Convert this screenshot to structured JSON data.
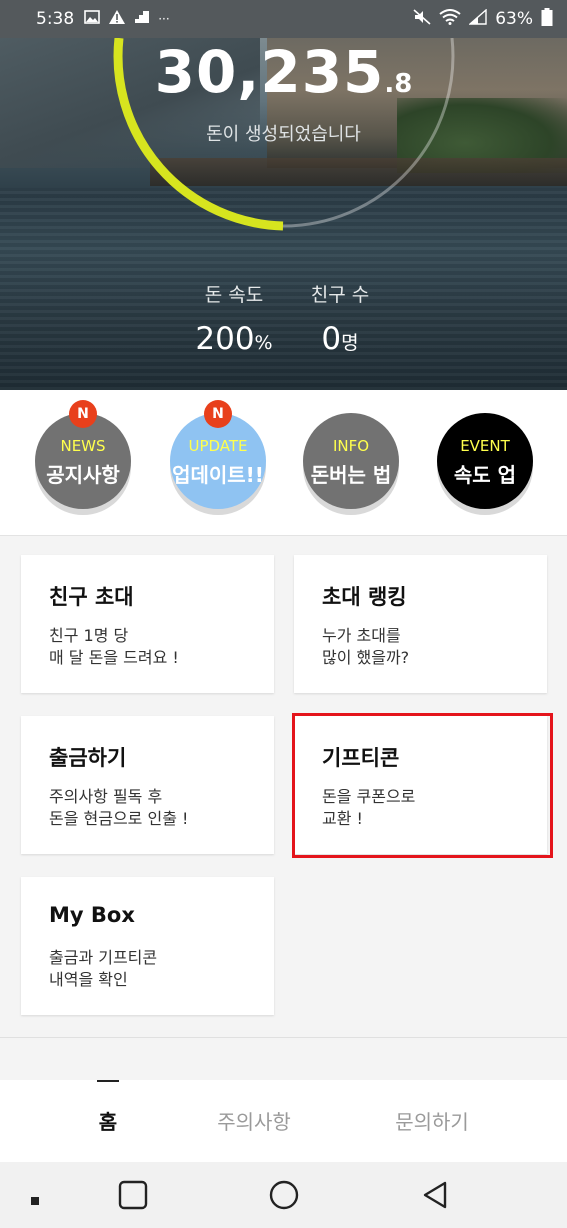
{
  "status_bar": {
    "time": "5:38",
    "more": "···",
    "battery": "63%"
  },
  "hero": {
    "amount_main": "30,235",
    "amount_decimal": ".8",
    "caption": "돈이 생성되었습니다",
    "speed_label": "돈 속도",
    "speed_value": "200",
    "speed_unit": "%",
    "friends_label": "친구 수",
    "friends_value": "0",
    "friends_unit": "명",
    "ring_color": "#d7e41f"
  },
  "menu": [
    {
      "eng": "NEWS",
      "kor": "공지사항",
      "badge": "N",
      "bg": "#727272"
    },
    {
      "eng": "UPDATE",
      "kor": "업데이트!!",
      "badge": "N",
      "bg": "#8fc3f2"
    },
    {
      "eng": "INFO",
      "kor": "돈버는 법",
      "bg": "#727272"
    },
    {
      "eng": "EVENT",
      "kor": "속도 업",
      "bg": "#000000"
    }
  ],
  "cards": [
    {
      "title": "친구 초대",
      "desc": "친구 1명 당\n매 달 돈을 드려요 !"
    },
    {
      "title": "초대 랭킹",
      "desc": "누가 초대를\n많이 했을까?"
    },
    {
      "title": "출금하기",
      "desc": "주의사항 필독 후\n돈을 현금으로 인출 !"
    },
    {
      "title": "기프티콘",
      "desc": "돈을 쿠폰으로\n교환 !"
    },
    {
      "title": "My Box",
      "desc": "출금과 기프티콘\n내역을 확인"
    }
  ],
  "tabs": [
    {
      "label": "홈",
      "active": true
    },
    {
      "label": "주의사항",
      "active": false
    },
    {
      "label": "문의하기",
      "active": false
    }
  ],
  "colors": {
    "highlight": "#e4141b",
    "badge": "#e8401c"
  }
}
